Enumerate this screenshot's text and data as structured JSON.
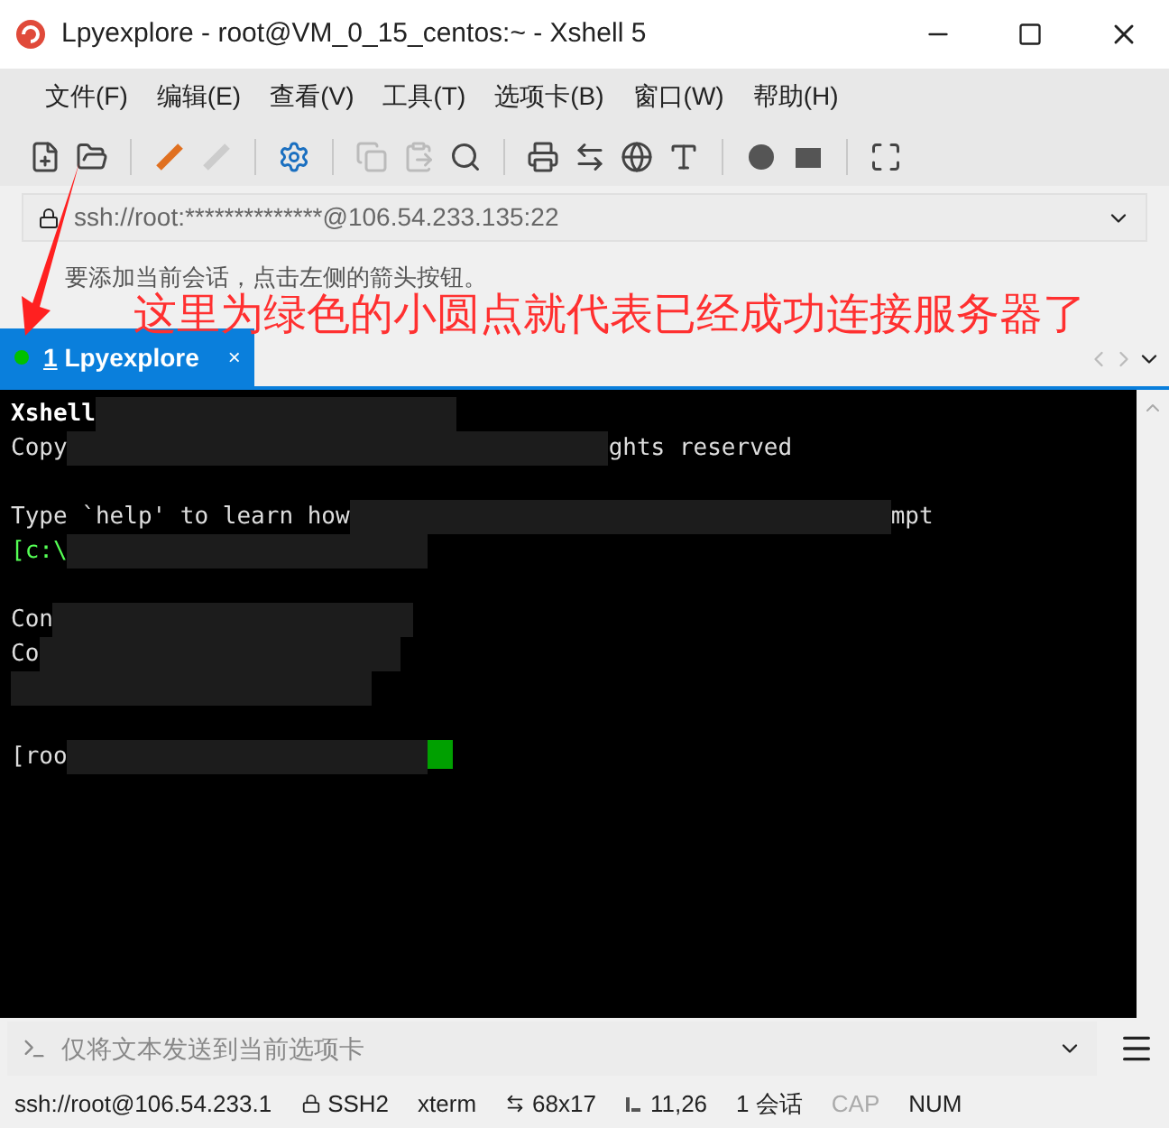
{
  "window": {
    "title": "Lpyexplore - root@VM_0_15_centos:~ - Xshell 5"
  },
  "menu": [
    "文件(F)",
    "编辑(E)",
    "查看(V)",
    "工具(T)",
    "选项卡(B)",
    "窗口(W)",
    "帮助(H)"
  ],
  "address": {
    "value": "ssh://root:**************@106.54.233.135:22"
  },
  "hint": "要添加当前会话，点击左侧的箭头按钮。",
  "annotation": "这里为绿色的小圆点就代表已经成功连接服务器了",
  "tabs": [
    {
      "number": "1",
      "label": "Lpyexplore",
      "selected": true,
      "connected": true,
      "close": "×"
    }
  ],
  "terminal": {
    "lines": [
      {
        "kind": "bold",
        "parts": [
          "Xshell"
        ],
        "redacted": true
      },
      {
        "kind": "plain",
        "parts": [
          "Copy",
          "ghts reserved"
        ],
        "redacted": true
      },
      {
        "kind": "blank"
      },
      {
        "kind": "plain",
        "parts": [
          "Type `help' to learn how",
          "mpt"
        ],
        "redacted": true
      },
      {
        "kind": "green",
        "parts": [
          "[c:\\"
        ],
        "redacted": true
      },
      {
        "kind": "blank"
      },
      {
        "kind": "plain",
        "parts": [
          "Con"
        ],
        "redacted": true
      },
      {
        "kind": "plain",
        "parts": [
          "Co"
        ],
        "redacted": true
      },
      {
        "kind": "plain",
        "redacted": true
      },
      {
        "kind": "blank"
      },
      {
        "kind": "cursor",
        "parts": [
          "[roo"
        ],
        "redacted": true
      }
    ]
  },
  "compose": {
    "placeholder": "仅将文本发送到当前选项卡"
  },
  "status_bar": [
    {
      "kind": "text",
      "text": "ssh://root@106.54.233.1",
      "disabled": false
    },
    {
      "kind": "lock",
      "text": "SSH2",
      "disabled": false
    },
    {
      "kind": "text",
      "text": "xterm",
      "disabled": false
    },
    {
      "kind": "size",
      "text": "68x17",
      "disabled": false
    },
    {
      "kind": "pos",
      "text": "11,26",
      "disabled": false
    },
    {
      "kind": "text",
      "text": "1 会话",
      "disabled": false
    },
    {
      "kind": "text",
      "text": "CAP",
      "disabled": true
    },
    {
      "kind": "text",
      "text": "NUM",
      "disabled": false
    }
  ]
}
